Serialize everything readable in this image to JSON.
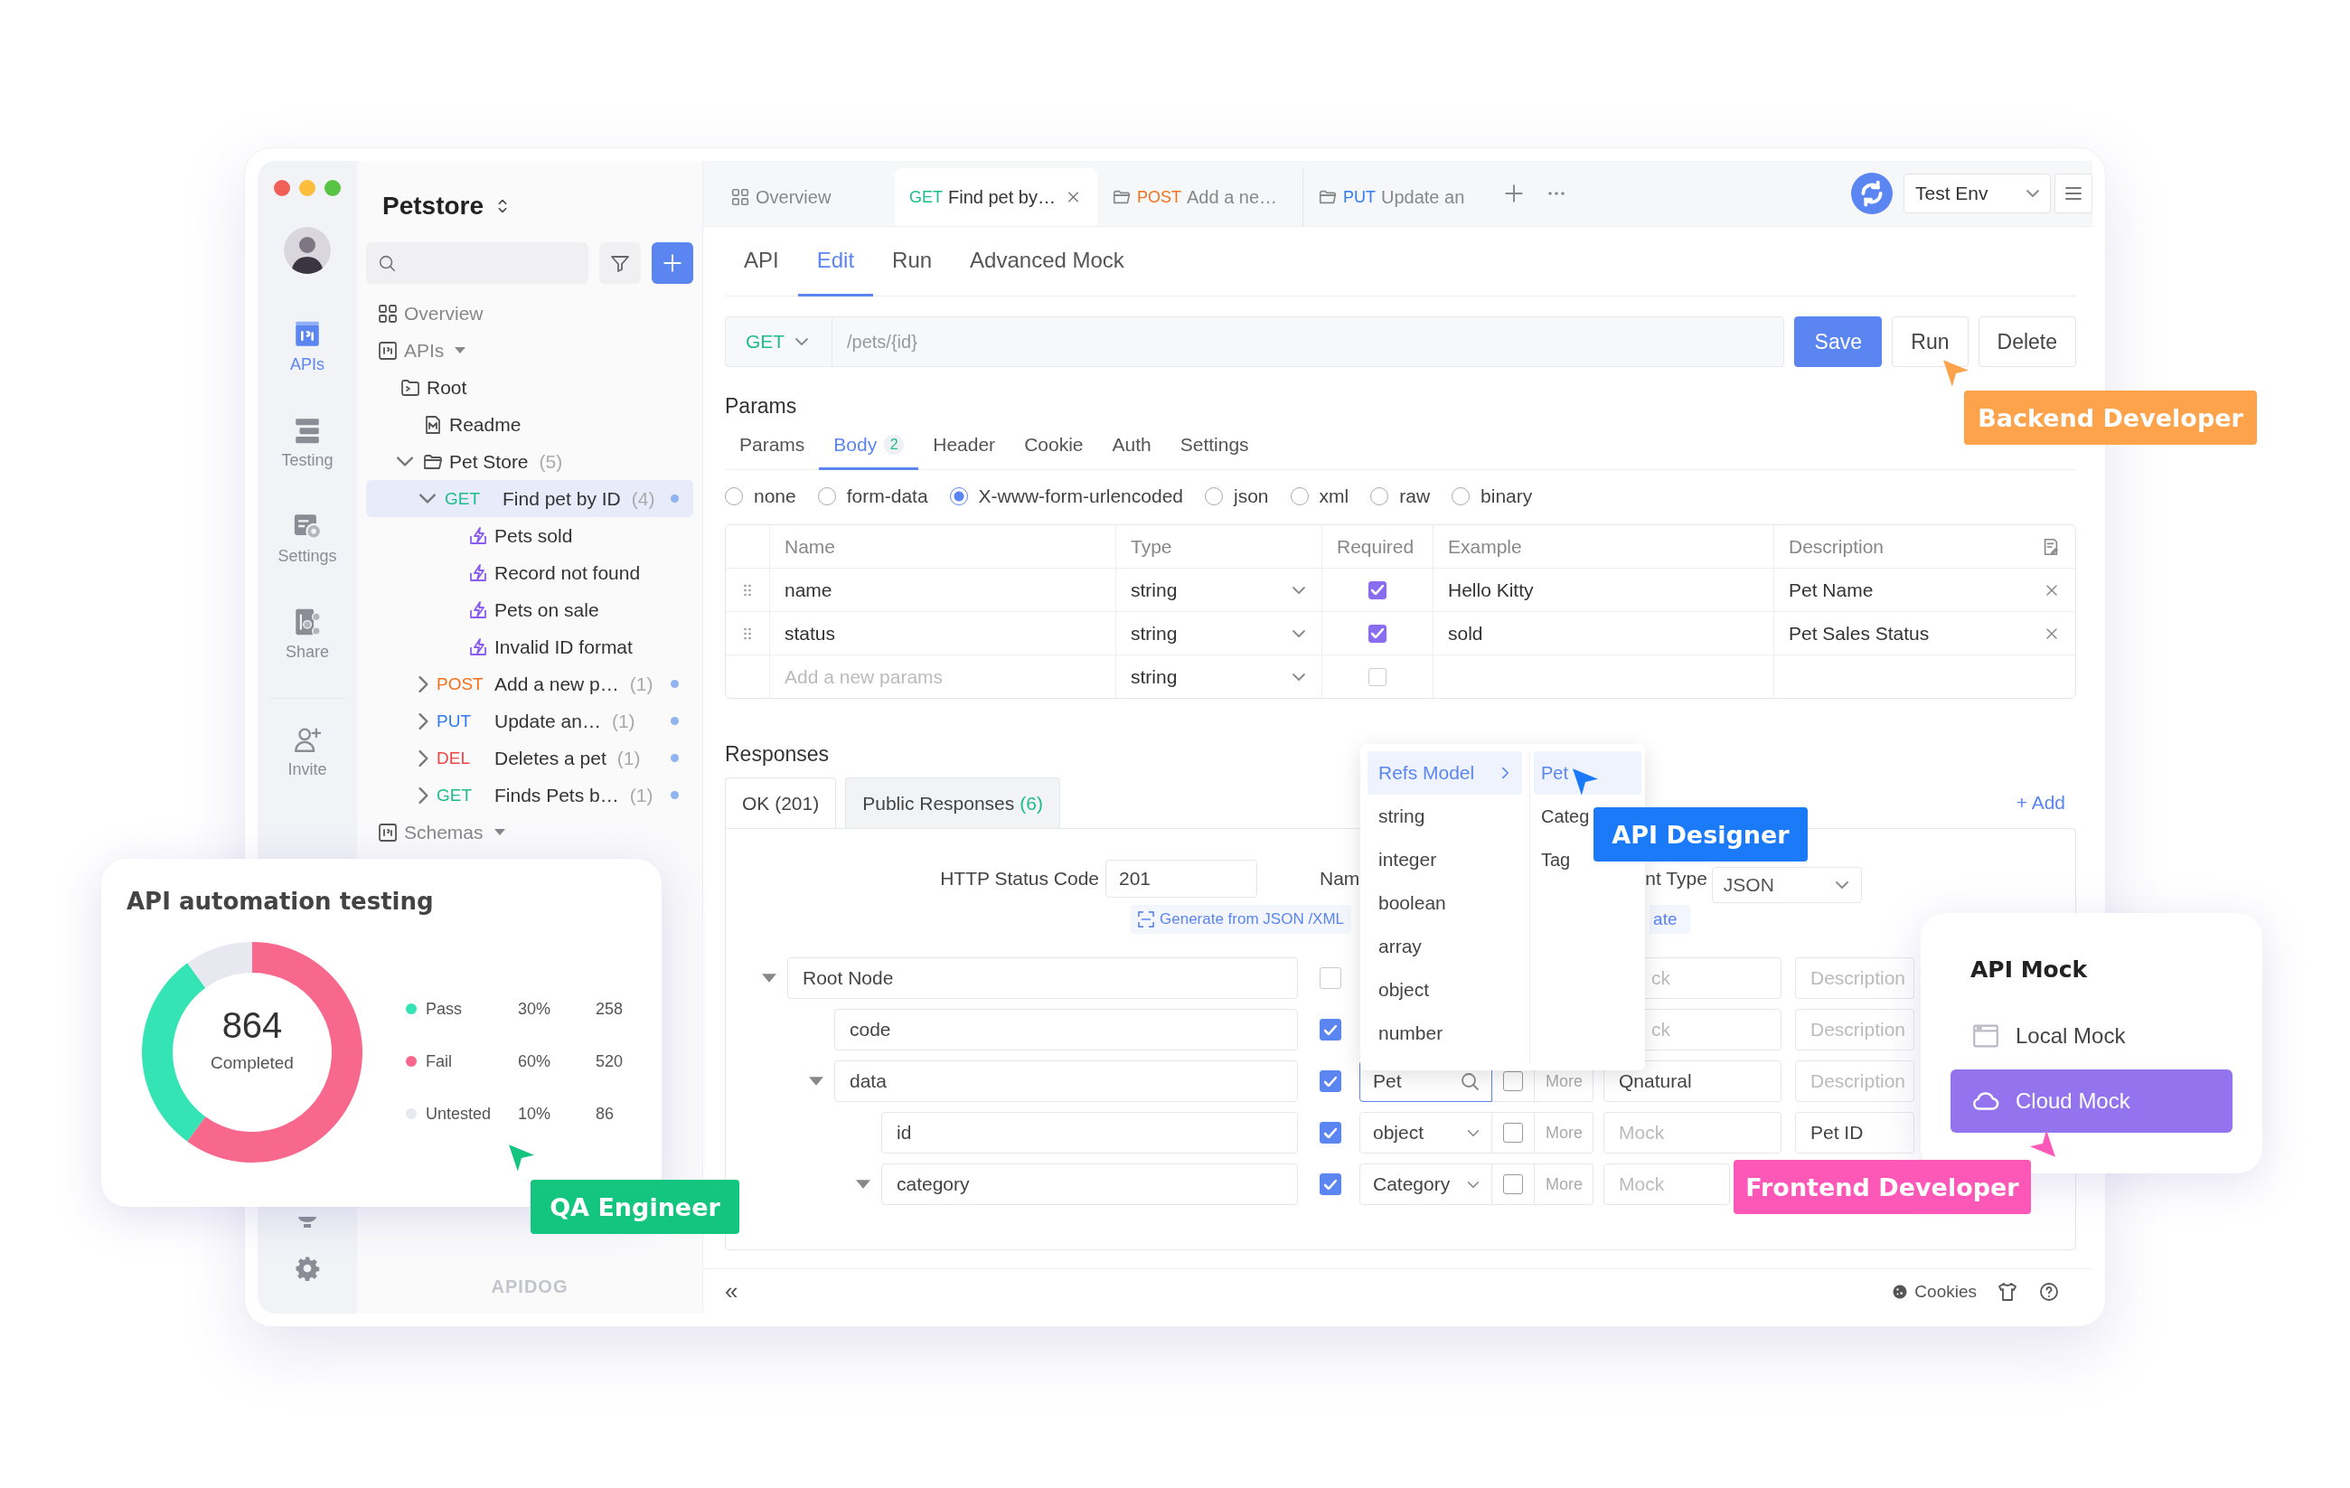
{
  "window": {
    "controls": [
      {
        "color": "#f25f58"
      },
      {
        "color": "#fbbe3c"
      },
      {
        "color": "#58c443"
      }
    ]
  },
  "rail": {
    "items": [
      {
        "kind": "apis",
        "label": "APIs",
        "selected": true
      },
      {
        "kind": "testing",
        "label": "Testing",
        "selected": false
      },
      {
        "kind": "settings",
        "label": "Settings",
        "selected": false
      },
      {
        "kind": "share",
        "label": "Share",
        "selected": false
      },
      {
        "kind": "invite",
        "label": "Invite",
        "selected": false
      }
    ]
  },
  "sidebar": {
    "title": "Petstore",
    "footer_logo": "APIDOG",
    "tree": [
      {
        "kind": "overview",
        "label": "Overview",
        "selected": false
      },
      {
        "kind": "section",
        "label": "APIs",
        "expanded": true,
        "selected": false,
        "children": [
          {
            "kind": "root",
            "label": "Root",
            "selected": false,
            "children": [
              {
                "kind": "doc",
                "label": "Readme",
                "selected": false
              },
              {
                "kind": "folder",
                "label": "Pet Store",
                "count": "(5)",
                "expanded": true,
                "selected": false,
                "children": [
                  {
                    "kind": "endpoint",
                    "method": "GET",
                    "color": "#1fbc8b",
                    "label": "Find pet by ID",
                    "count": "(4)",
                    "expanded": true,
                    "selected": true,
                    "children": [
                      {
                        "kind": "case",
                        "label": "Pets sold",
                        "selected": false
                      },
                      {
                        "kind": "case",
                        "label": "Record not found",
                        "selected": false
                      },
                      {
                        "kind": "case",
                        "label": "Pets on sale",
                        "selected": false
                      },
                      {
                        "kind": "case",
                        "label": "Invalid ID format",
                        "selected": false
                      }
                    ]
                  },
                  {
                    "kind": "endpoint",
                    "method": "POST",
                    "color": "#f2711c",
                    "label": "Add a new p…",
                    "count": "(1)",
                    "expanded": false,
                    "selected": false
                  },
                  {
                    "kind": "endpoint",
                    "method": "PUT",
                    "color": "#2f7bf5",
                    "label": "Update an…",
                    "count": "(1)",
                    "expanded": false,
                    "selected": false
                  },
                  {
                    "kind": "endpoint",
                    "method": "DEL",
                    "color": "#ef4444",
                    "label": "Deletes a pet",
                    "count": "(1)",
                    "expanded": false,
                    "selected": false
                  },
                  {
                    "kind": "endpoint",
                    "method": "GET",
                    "color": "#1fbc8b",
                    "label": "Finds Pets b…",
                    "count": "(1)",
                    "expanded": false,
                    "selected": false
                  }
                ]
              }
            ]
          }
        ]
      },
      {
        "kind": "section",
        "label": "Schemas",
        "expanded": true,
        "selected": false
      }
    ]
  },
  "tabs": [
    {
      "kind": "overview",
      "label": "Overview",
      "selected": false
    },
    {
      "kind": "endpoint",
      "method": "GET",
      "color": "#1fbc8b",
      "label": "Find pet by…",
      "selected": true
    },
    {
      "kind": "endpoint",
      "method": "POST",
      "color": "#f2711c",
      "label": "Add a ne…",
      "selected": false
    },
    {
      "kind": "endpoint",
      "method": "PUT",
      "color": "#2f7bf5",
      "label": "Update an",
      "selected": false
    }
  ],
  "environment": "Test Env",
  "subtabs": [
    {
      "label": "API",
      "selected": false
    },
    {
      "label": "Edit",
      "selected": true
    },
    {
      "label": "Run",
      "selected": false
    },
    {
      "label": "Advanced Mock",
      "selected": false
    }
  ],
  "request": {
    "method": "GET",
    "path": "/pets/{id}",
    "buttons": [
      {
        "label": "Save",
        "kind": "primary"
      },
      {
        "label": "Run",
        "kind": "default"
      },
      {
        "label": "Delete",
        "kind": "default"
      }
    ]
  },
  "params": {
    "title": "Params",
    "tabs": [
      {
        "label": "Params",
        "selected": false
      },
      {
        "label": "Body",
        "count": "2",
        "selected": true
      },
      {
        "label": "Header",
        "selected": false
      },
      {
        "label": "Cookie",
        "selected": false
      },
      {
        "label": "Auth",
        "selected": false
      },
      {
        "label": "Settings",
        "selected": false
      }
    ],
    "body_types": [
      {
        "label": "none",
        "selected": false
      },
      {
        "label": "form-data",
        "selected": false
      },
      {
        "label": "X-www-form-urlencoded",
        "selected": true
      },
      {
        "label": "json",
        "selected": false
      },
      {
        "label": "xml",
        "selected": false
      },
      {
        "label": "raw",
        "selected": false
      },
      {
        "label": "binary",
        "selected": false
      }
    ],
    "table": {
      "columns": [
        "Name",
        "Type",
        "Required",
        "Example",
        "Description"
      ],
      "rows": [
        {
          "kind": "param",
          "name": "name",
          "type": "string",
          "required": true,
          "example": "Hello Kitty",
          "description": "Pet Name"
        },
        {
          "kind": "param",
          "name": "status",
          "type": "string",
          "required": true,
          "example": "sold",
          "description": "Pet Sales Status"
        },
        {
          "kind": "new",
          "placeholder": "Add a new params",
          "type": "string",
          "required": false
        }
      ]
    }
  },
  "responses": {
    "title": "Responses",
    "tabs": [
      {
        "label": "OK (201)",
        "selected": true
      },
      {
        "label": "Public Responses",
        "count": "(6)",
        "selected": false
      }
    ],
    "add": "+ Add",
    "form": {
      "status_label": "HTTP Status Code",
      "status_value": "201",
      "name_label": "Nam",
      "content_type_label": "nt Type",
      "content_type": "JSON",
      "generate_link": "Generate from JSON /XML",
      "link_fragment": "ate"
    },
    "schema": [
      {
        "name": "Root Node",
        "required": false,
        "expanded": true,
        "mock": {
          "placeholder": "ck"
        },
        "description": {
          "placeholder": "Description"
        },
        "children": [
          {
            "name": "code",
            "required": true,
            "mock": {
              "placeholder": "ck"
            },
            "description": {
              "placeholder": "Description"
            }
          },
          {
            "name": "data",
            "required": true,
            "expanded": true,
            "type": {
              "kind": "search",
              "value": "Pet"
            },
            "nullable": false,
            "more": "More",
            "mock": {
              "value": "Qnatural"
            },
            "description": {
              "placeholder": "Description"
            },
            "children": [
              {
                "name": "id",
                "required": true,
                "type": {
                  "kind": "select",
                  "value": "object"
                },
                "nullable": false,
                "more": "More",
                "mock": {
                  "placeholder": "Mock"
                },
                "description": {
                  "value": "Pet ID"
                }
              },
              {
                "name": "category",
                "required": true,
                "expanded": true,
                "type": {
                  "kind": "select",
                  "value": "Category"
                },
                "nullable": false,
                "more": "More",
                "mock": {
                  "placeholder": "Mock"
                }
              }
            ]
          }
        ]
      }
    ]
  },
  "type_menu": {
    "items": [
      {
        "label": "Refs Model",
        "submenu": true,
        "selected": true
      },
      {
        "label": "string",
        "selected": false
      },
      {
        "label": "integer",
        "selected": false
      },
      {
        "label": "boolean",
        "selected": false
      },
      {
        "label": "array",
        "selected": false
      },
      {
        "label": "object",
        "selected": false
      },
      {
        "label": "number",
        "selected": false
      }
    ],
    "submenu": [
      {
        "label": "Pet",
        "selected": true
      },
      {
        "label": "Categ",
        "selected": false
      },
      {
        "label": "Tag",
        "selected": false
      }
    ]
  },
  "status_bar": {
    "collapse": "«",
    "cookies": "Cookies"
  },
  "test_report": {
    "title": "API automation testing",
    "total": "864",
    "total_label": "Completed",
    "legend": [
      {
        "percent": "30%",
        "count": "258",
        "color": "#34e4b4"
      },
      {
        "percent": "60%",
        "count": "520",
        "color": "#f7688c"
      },
      {
        "percent": "10%",
        "count": "86",
        "color": "#e8e8f0"
      }
    ],
    "chart_data": {
      "type": "donut",
      "categories": [
        "Pass",
        "Fail",
        "Untested"
      ],
      "series": [
        {
          "values": [
            30,
            60,
            10
          ]
        }
      ]
    }
  },
  "mock_panel": {
    "title": "API Mock",
    "items": [
      {
        "kind": "local",
        "label": "Local Mock",
        "selected": false
      },
      {
        "kind": "cloud",
        "label": "Cloud Mock",
        "selected": true
      }
    ]
  },
  "roles": [
    {
      "label": "Backend Developer",
      "color": "#fca34b"
    },
    {
      "label": "API Designer",
      "color": "#1a7af8"
    },
    {
      "label": "QA Engineer",
      "color": "#13c57e"
    },
    {
      "label": "Frontend Developer",
      "color": "#fd57b7"
    }
  ]
}
